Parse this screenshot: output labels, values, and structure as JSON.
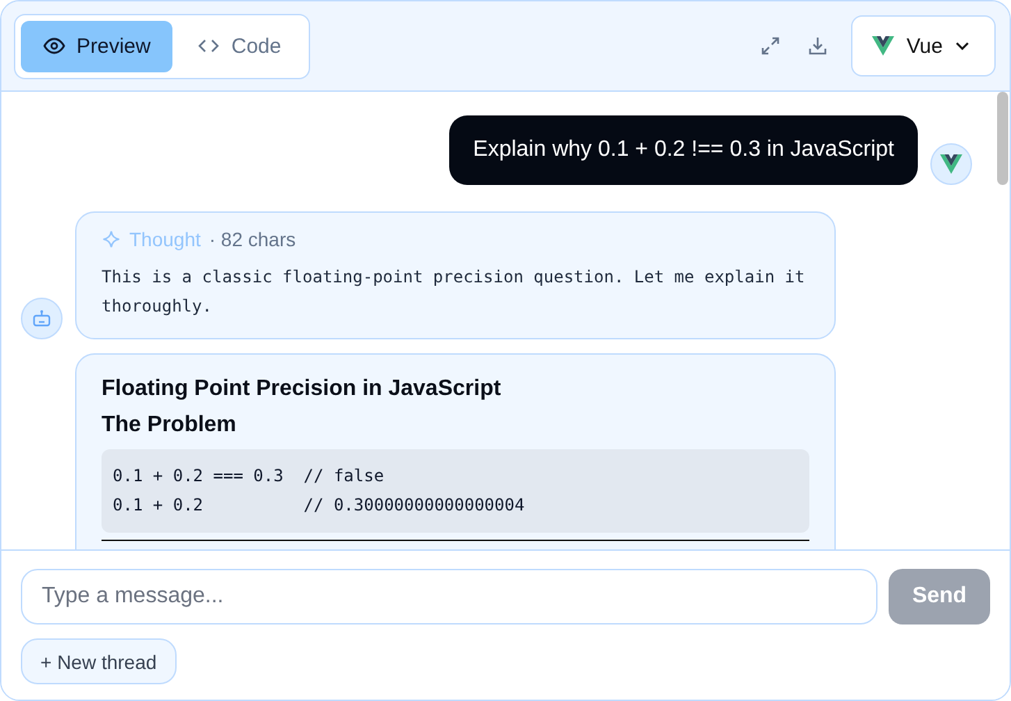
{
  "toolbar": {
    "tabs": [
      {
        "kind": "preview",
        "label": "Preview",
        "selected": true
      },
      {
        "kind": "code",
        "label": "Code",
        "selected": false
      }
    ],
    "framework": {
      "label": "Vue"
    }
  },
  "messages": [
    {
      "kind": "user",
      "text": "Explain why 0.1 + 0.2 !== 0.3 in JavaScript"
    },
    {
      "kind": "thought",
      "label": "Thought",
      "meta": "· 82 chars",
      "text": "This is a classic floating-point precision question. Let me explain it thoroughly."
    },
    {
      "kind": "answer",
      "title": "Floating Point Precision in JavaScript",
      "subtitle": "The Problem",
      "code": [
        "0.1 + 0.2 === 0.3  // false",
        "0.1 + 0.2          // 0.30000000000000004"
      ]
    }
  ],
  "composer": {
    "placeholder": "Type a message...",
    "send": {
      "label": "Send",
      "disabled": true
    },
    "new_thread": "+ New thread"
  }
}
